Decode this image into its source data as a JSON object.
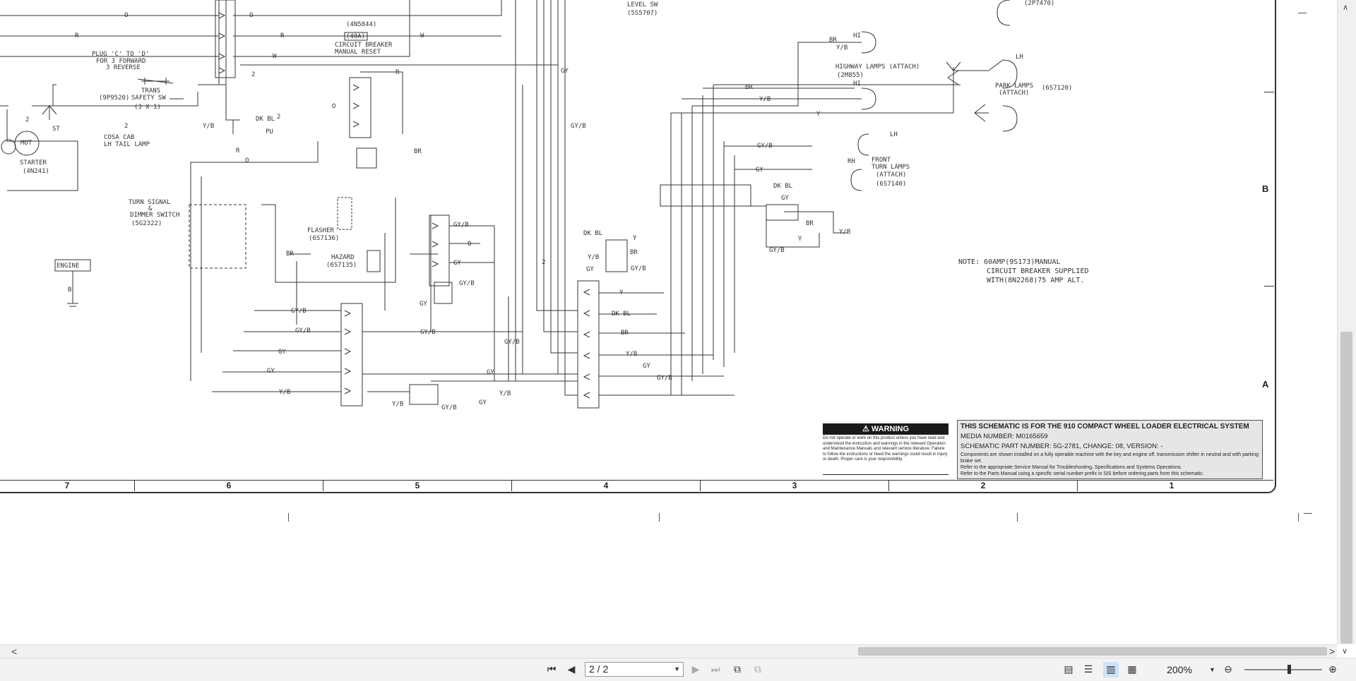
{
  "schematic": {
    "labels": {
      "wire_o1": "O",
      "wire_o2": "O",
      "wire_r1": "R",
      "wire_r2": "R",
      "wire_w1": "W",
      "wire_w2": "W",
      "breaker_part": "(4N5844)",
      "breaker_rating": "(40A)",
      "breaker_name": "CIRCUIT BREAKER",
      "breaker_sub": "MANUAL RESET",
      "level_sw": "LEVEL SW",
      "level_sw_part": "(5S5707)",
      "top_part": "(2P7470)",
      "plug_note1": "PLUG 'C' TO 'D'",
      "plug_note2": "FOR 3 FORWARD",
      "plug_note3": "3 REVERSE",
      "trans_sw1": "TRANS",
      "trans_sw2": "SAFETY SW",
      "trans_sw_part": "(9P9520)",
      "trans_sw_ratio": "(3 X 1)",
      "circle2a": "2",
      "circle2b": "2",
      "circle2c": "2",
      "circle2d": "2",
      "circle2e": "2",
      "mot": "MOT",
      "st": "ST",
      "starter": "STARTER",
      "starter_part": "(4N241)",
      "cosa_cab1": "COSA CAB",
      "cosa_cab2": "LH TAIL LAMP",
      "turn_signal1": "TURN SIGNAL",
      "turn_signal2": "&",
      "turn_signal3": "DIMMER SWITCH",
      "turn_signal_part": "(5G2322)",
      "engine": "ENGINE",
      "engine_b": "B",
      "flasher": "FLASHER",
      "flasher_part": "(6S7136)",
      "hazard": "HAZARD",
      "hazard_part": "(6S7135)",
      "highway_lamps": "HIGHWAY LAMPS (ATTACH)",
      "highway_part": "(2M855)",
      "park_lamps": "PARK LAMPS",
      "park_attach": "(ATTACH)",
      "park_part": "(6S7120)",
      "front_turn1": "FRONT",
      "front_turn2": "TURN LAMPS",
      "front_turn3": "(ATTACH)",
      "front_turn_part": "(6S7140)",
      "hi1": "HI",
      "hi2": "HI",
      "lh1": "LH",
      "lh2": "LH",
      "rh": "RH",
      "br1": "BR",
      "yb1": "Y/B",
      "br2": "BR",
      "yb2": "Y/B",
      "y1": "Y",
      "gyb1": "GY/B",
      "gy1": "GY",
      "dkbl1": "DK BL",
      "gy2": "GY",
      "br3": "BR",
      "yb3": "Y/B",
      "gyb2": "GY/B",
      "y2": "Y",
      "dkbl2": "DK BL",
      "y3": "Y",
      "br4": "BR",
      "yb4": "Y/B",
      "gyb3": "GY/B",
      "gy3": "GY",
      "y4": "Y",
      "dkbl3": "DK BL",
      "br5": "BR",
      "yb5": "Y/B",
      "gy4": "GY",
      "gyb4": "GY/B",
      "gyb5": "GY/B",
      "gyb6": "GY/B",
      "gyb7": "GY/B",
      "gy5": "GY",
      "gy6": "GY",
      "yb6": "Y/B",
      "gyb8": "GY/B",
      "o3": "O",
      "gy7": "GY",
      "gyb9": "GY/B",
      "gy8": "GY",
      "gy9": "GY",
      "yb7": "Y/B",
      "gyb10": "GY/B",
      "gy10": "GY",
      "yb8": "Y/B",
      "br6": "BR",
      "br7": "BR",
      "r3": "R",
      "o4": "O",
      "r4": "R",
      "o5": "O",
      "gy11": "GY",
      "gyb11": "GY/B",
      "dkbl4": "DK BL",
      "pu": "PU",
      "yb9": "Y/B",
      "note1": "NOTE:  60AMP(9S173)MANUAL",
      "note2": "CIRCUIT BREAKER SUPPLIED",
      "note3": "WITH(8N2268)75 AMP ALT.",
      "ybl": "Y/B",
      "y5": "Y"
    },
    "zones": [
      "7",
      "6",
      "5",
      "4",
      "3",
      "2",
      "1"
    ],
    "rows": [
      "B",
      "A"
    ],
    "warning": {
      "heading": "⚠ WARNING",
      "text": "Do not operate or work on this product unless you have read and understood the instruction and warnings in the relevant Operation and Maintenance Manuals and relevant service literature. Failure to follow the instructions or heed the warnings could result in injury or death. Proper care is your responsibility."
    },
    "title_block": {
      "title": "THIS SCHEMATIC IS FOR THE 910 COMPACT WHEEL LOADER ELECTRICAL SYSTEM",
      "media": "MEDIA NUMBER: M0165659",
      "part": "SCHEMATIC PART NUMBER: 5G-2781, CHANGE: 08, VERSION: -",
      "note1": "Components are shown installed on a fully operable machine with the key and engine off, transmission shifter in neutral and with parking brake set.",
      "note2": "Refer to the appropriate Service Manual for Troubleshooting, Specifications and Systems Operations.",
      "note3": "Refer to the Parts Manual using a specific serial number prefix in SIS before ordering parts from this schematic."
    }
  },
  "toolbar": {
    "page_field": "2 / 2",
    "zoom": "200%",
    "icons": [
      "first-page-icon",
      "previous-page-icon",
      "next-page-icon",
      "last-page-icon",
      "rotate-icon",
      "compare-icon",
      "single-page-icon",
      "continuous-icon",
      "two-page-icon",
      "two-page-continuous-icon",
      "zoom-out-icon",
      "zoom-in-icon"
    ]
  }
}
